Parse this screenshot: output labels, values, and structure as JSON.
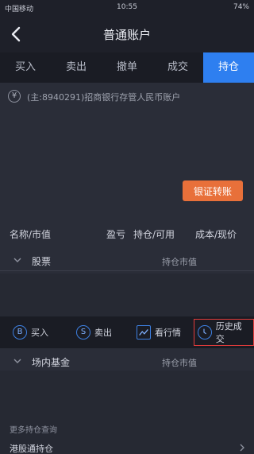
{
  "status_bar": {
    "carrier": "中国移动",
    "time": "10:55",
    "battery": "74%"
  },
  "nav": {
    "title": "普通账户"
  },
  "tabs": [
    {
      "label": "买入"
    },
    {
      "label": "卖出"
    },
    {
      "label": "撤单"
    },
    {
      "label": "成交"
    },
    {
      "label": "持仓"
    }
  ],
  "account": {
    "currency_icon": "¥",
    "text": "(主:8940291)招商银行存管人民币账户"
  },
  "transfer_button": {
    "label": "银证转账"
  },
  "column_headers": {
    "name": "名称/市值",
    "pnl": "盈亏",
    "position": "持仓/可用",
    "cost": "成本/现价"
  },
  "sections": [
    {
      "name": "股票",
      "value_label": "持仓市值"
    },
    {
      "name": "场内基金",
      "value_label": "持仓市值"
    }
  ],
  "toolbar": {
    "buy": {
      "icon": "B",
      "label": "买入"
    },
    "sell": {
      "icon": "S",
      "label": "卖出"
    },
    "quote": {
      "label": "看行情"
    },
    "history": {
      "label": "历史成交"
    }
  },
  "footer": {
    "more_query": "更多持仓查询",
    "hk_connect": "港股通持仓"
  },
  "colors": {
    "accent": "#2e7ff0",
    "transfer_button": "#e8703a",
    "highlight_box": "#e23b3b"
  },
  "icons": {
    "back": "back-arrow-icon",
    "yen": "yen-icon",
    "chevron": "chevron-down-icon",
    "buy": "buy-icon",
    "sell": "sell-icon",
    "quote": "chart-icon",
    "history": "clock-icon"
  }
}
